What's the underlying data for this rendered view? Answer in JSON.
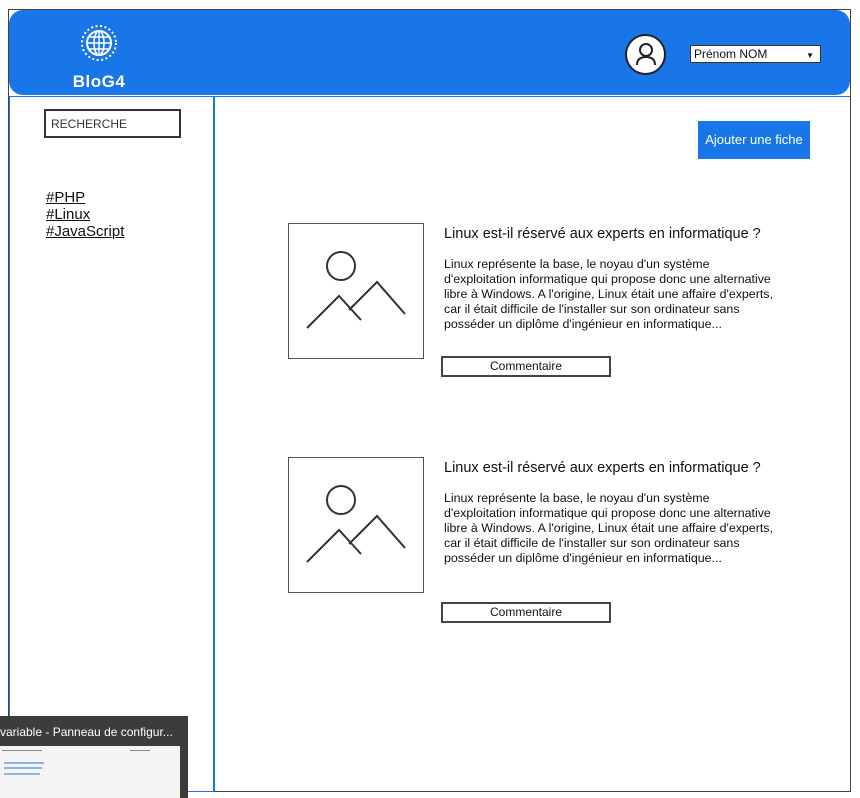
{
  "header": {
    "logo_text": "BloG4",
    "logo_icon": "globe-icon",
    "avatar_icon": "user-icon",
    "user_select_value": "Prénom NOM",
    "accent_color": "#1976e8"
  },
  "sidebar": {
    "search_placeholder": "RECHERCHE",
    "tags": [
      "#PHP",
      "#Linux",
      "#JavaScript"
    ]
  },
  "main": {
    "add_button_label": "Ajouter une fiche",
    "cards": [
      {
        "image_icon": "image-placeholder-icon",
        "title": "Linux est-il réservé aux experts en informatique ?",
        "text": "Linux représente la base, le noyau d'un système d'exploitation informatique qui propose donc une alternative libre à Windows. A l'origine, Linux était une affaire d'experts, car il était difficile de l'installer sur son ordinateur sans posséder un diplôme d'ingénieur en informatique...",
        "comment_label": "Commentaire"
      },
      {
        "image_icon": "image-placeholder-icon",
        "title": "Linux est-il réservé aux experts en informatique ?",
        "text": "Linux représente la base, le noyau d'un système d'exploitation informatique qui propose donc une alternative libre à Windows. A l'origine, Linux était une affaire d'experts, car il était difficile de l'installer sur son ordinateur sans posséder un diplôme d'ingénieur en informatique...",
        "comment_label": "Commentaire"
      }
    ]
  },
  "taskbar_thumbnail": {
    "title": "variable - Panneau de configur..."
  }
}
